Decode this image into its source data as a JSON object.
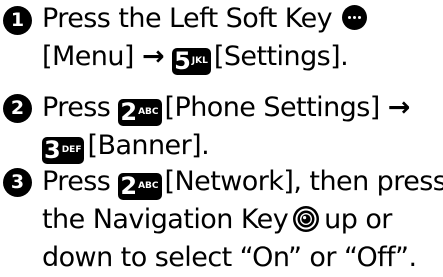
{
  "steps": [
    {
      "number": "1",
      "lines": [
        {
          "text_a": "Press the Left Soft Key"
        },
        {
          "text_a": "[Menu]",
          "arrow": "→",
          "key_digit": "5",
          "key_letters": "JKL",
          "text_b": "[Settings]."
        }
      ]
    },
    {
      "number": "2",
      "lines": [
        {
          "text_a": "Press",
          "key_digit": "2",
          "key_letters": "ABC",
          "text_b": "[Phone Settings]",
          "arrow": "→"
        },
        {
          "key_digit": "3",
          "key_letters": "DEF",
          "text_b": "[Banner]."
        }
      ]
    },
    {
      "number": "3",
      "lines": [
        {
          "text_a": "Press",
          "key_digit": "2",
          "key_letters": "ABC",
          "text_b": "[Network], then press"
        },
        {
          "text_a": "the Navigation Key",
          "text_b": "up or"
        },
        {
          "text_a": "down to select “On” or “Off”."
        }
      ]
    }
  ],
  "icons": {
    "left_soft_key": "left-soft-key-icon",
    "navigation_key": "navigation-key-icon"
  }
}
